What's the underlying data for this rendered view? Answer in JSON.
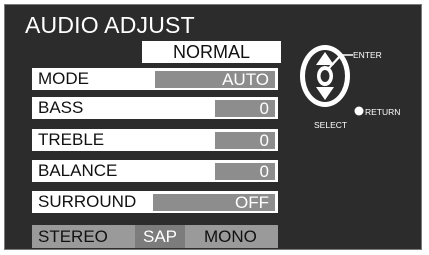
{
  "menu": {
    "title": "AUDIO ADJUST",
    "preset": "NORMAL",
    "items": [
      {
        "label": "MODE",
        "value": "AUTO"
      },
      {
        "label": "BASS",
        "value": "0"
      },
      {
        "label": "TREBLE",
        "value": "0"
      },
      {
        "label": "BALANCE",
        "value": "0"
      },
      {
        "label": "SURROUND",
        "value": "OFF"
      }
    ],
    "stereo": {
      "label": "STEREO",
      "options": [
        "SAP",
        "MONO"
      ],
      "selected": "SAP"
    }
  },
  "remote": {
    "enter_label": "ENTER",
    "select_label": "SELECT",
    "return_label": "RETURN",
    "icons": [
      "up-arrow-icon",
      "down-arrow-icon",
      "enter-button-icon",
      "return-button-icon"
    ]
  },
  "colors": {
    "panel": "#2c2c2c",
    "value_bar": "#8d8d8d",
    "row": "#ffffff"
  }
}
